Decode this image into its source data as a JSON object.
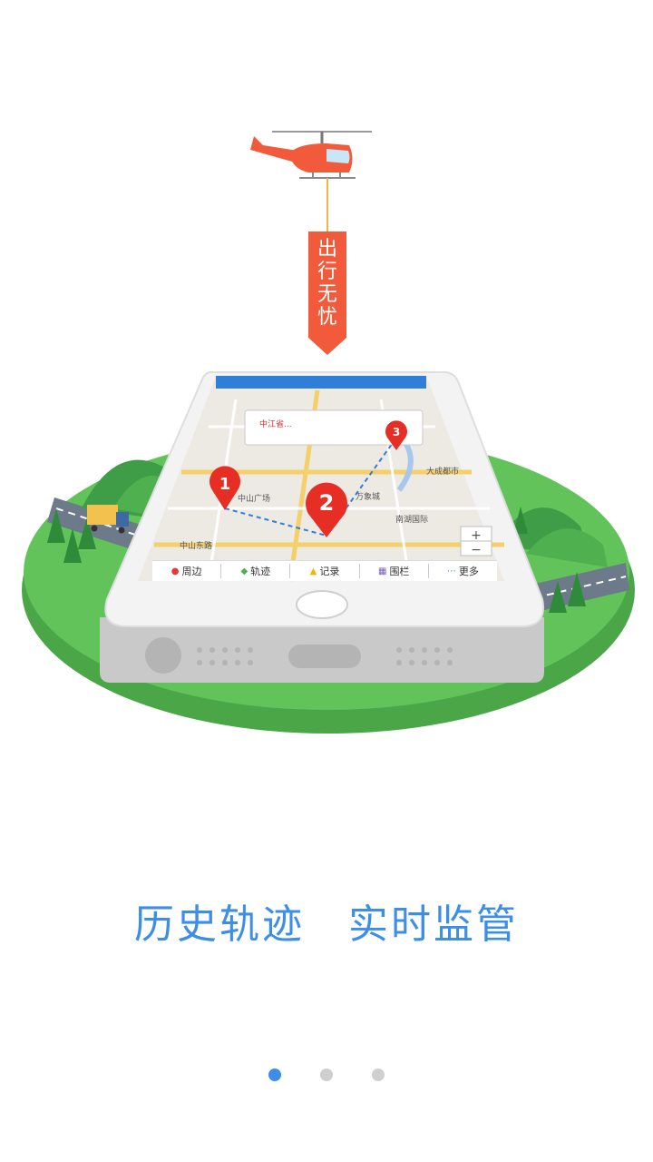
{
  "banner": {
    "text": "出行无忧"
  },
  "map": {
    "labels": [
      "中山东路",
      "中山广场",
      "万象城",
      "大成都市",
      "南湖国际"
    ],
    "info_card": "中江省...",
    "markers": [
      "1",
      "2",
      "3"
    ]
  },
  "tabs": [
    {
      "label": "周边",
      "icon": "pin-icon",
      "color": "#e53935"
    },
    {
      "label": "轨迹",
      "icon": "track-icon",
      "color": "#4caf50"
    },
    {
      "label": "记录",
      "icon": "warning-icon",
      "color": "#f4b400"
    },
    {
      "label": "围栏",
      "icon": "fence-icon",
      "color": "#7b5cc4"
    },
    {
      "label": "更多",
      "icon": "more-icon",
      "color": "#3d8ee6"
    }
  ],
  "headline": {
    "left": "历史轨迹",
    "right": "实时监管"
  },
  "pager": {
    "count": 3,
    "active": 1
  },
  "colors": {
    "accent": "#3d8ee6",
    "banner": "#f15a3a",
    "grass": "#5dc255"
  }
}
